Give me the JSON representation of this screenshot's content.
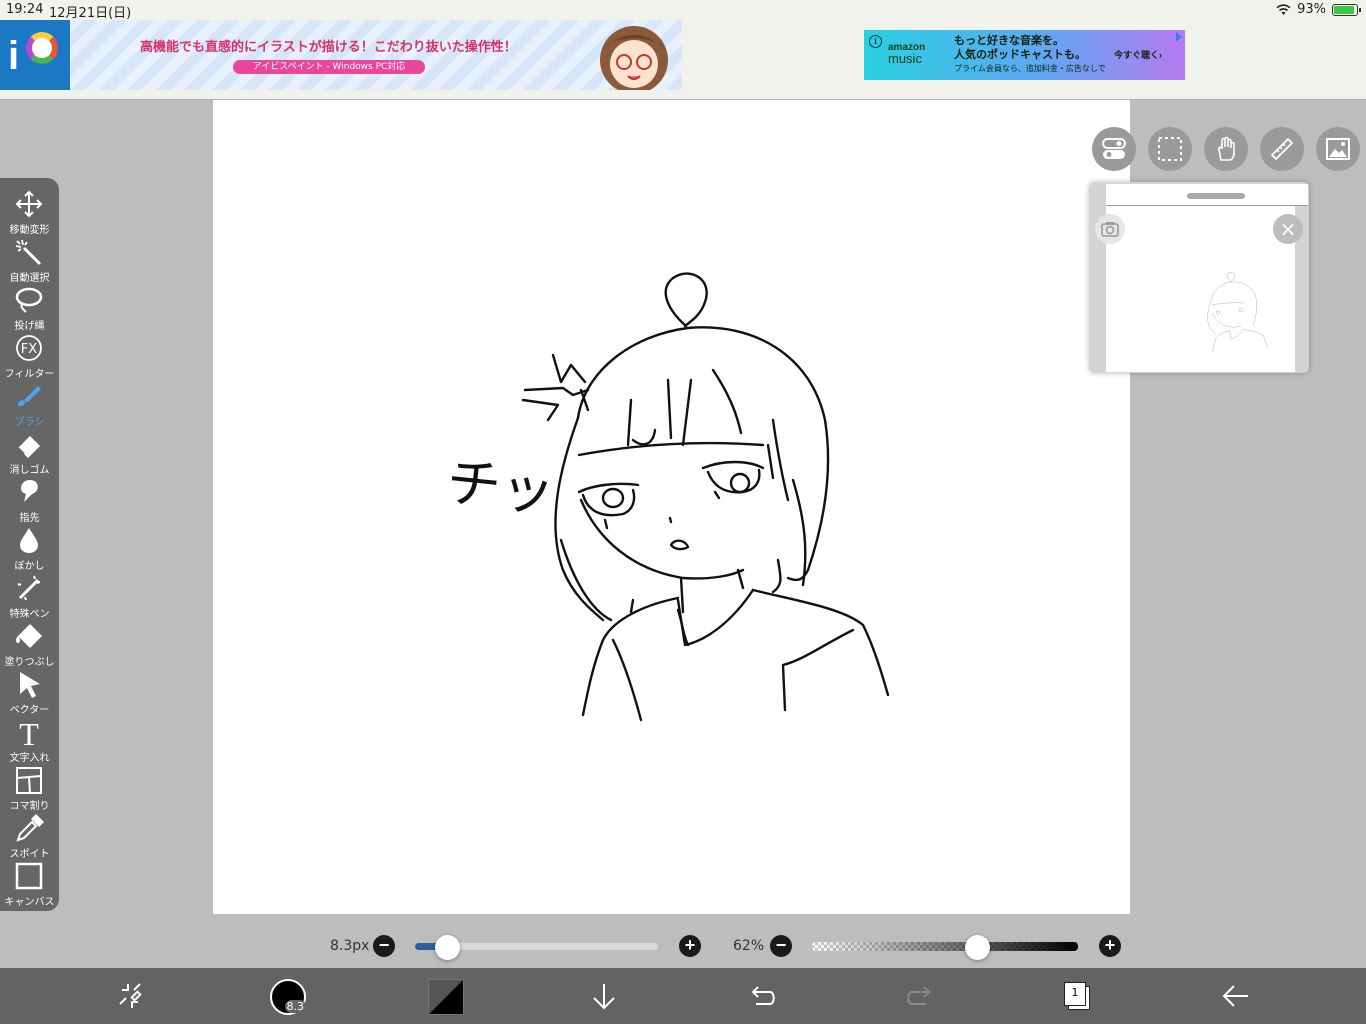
{
  "status": {
    "time": "19:24",
    "date": "12月21日(日)",
    "battery": "93%",
    "battery_level": 0.93
  },
  "ads": {
    "ad1": {
      "headline": "高機能でも直感的にイラストが描ける！こだわり抜いた操作性！",
      "subline": "アイビスペイント - Windows PC対応"
    },
    "ad2": {
      "brand_top": "amazon",
      "brand_bottom": "music",
      "line1": "もっと好きな音楽を。",
      "line2": "人気のポッドキャストも。",
      "line3": "プライム会員なら、追加料金・広告なしで",
      "cta": "今すぐ聴く›"
    }
  },
  "toolbar": {
    "items": [
      {
        "label": "移動変形",
        "icon": "move-transform-icon"
      },
      {
        "label": "自動選択",
        "icon": "magic-wand-icon"
      },
      {
        "label": "投げ縄",
        "icon": "lasso-icon"
      },
      {
        "label": "フィルター",
        "icon": "fx-filter-icon"
      },
      {
        "label": "ブラシ",
        "icon": "brush-icon",
        "active": true
      },
      {
        "label": "消しゴム",
        "icon": "eraser-icon"
      },
      {
        "label": "指先",
        "icon": "smudge-finger-icon"
      },
      {
        "label": "ぼかし",
        "icon": "blur-drop-icon"
      },
      {
        "label": "特殊ペン",
        "icon": "special-pen-icon"
      },
      {
        "label": "塗りつぶし",
        "icon": "fill-bucket-icon"
      },
      {
        "label": "ベクター",
        "icon": "vector-arrow-icon"
      },
      {
        "label": "文字入れ",
        "icon": "text-icon"
      },
      {
        "label": "コマ割り",
        "icon": "frame-divider-icon"
      },
      {
        "label": "スポイト",
        "icon": "eyedropper-icon"
      },
      {
        "label": "キャンバス",
        "icon": "canvas-icon"
      }
    ],
    "fx_glyph": "FX",
    "text_glyph": "T"
  },
  "top_tools": [
    "toggle-icon",
    "selection-icon",
    "hand-icon",
    "ruler-icon",
    "image-icon"
  ],
  "brush": {
    "size_label": "8.3px",
    "size_fraction": 0.13,
    "size_badge": "8.3"
  },
  "opacity": {
    "label": "62%",
    "fraction": 0.62
  },
  "drawing": {
    "onomatopoeia": "チッ"
  },
  "layers": {
    "count": "1"
  },
  "colors": {
    "accent": "#4aa3f0",
    "toolbar_bg": "#666666",
    "slider_fill": "#2b5f9e"
  }
}
